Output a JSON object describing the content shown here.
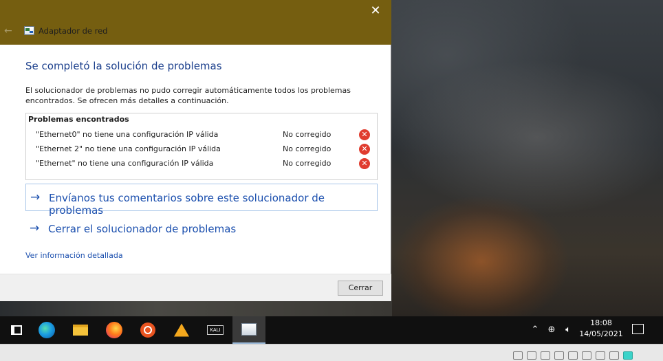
{
  "window": {
    "title": "Adaptador de red",
    "heading": "Se completó la solución de problemas",
    "description": "El solucionador de problemas no pudo corregir automáticamente todos los problemas encontrados. Se ofrecen más detalles a continuación.",
    "problems": {
      "header": "Problemas encontrados",
      "rows": [
        {
          "description": "\"Ethernet0\" no tiene una configuración IP válida",
          "status": "No corregido"
        },
        {
          "description": "\"Ethernet 2\" no tiene una configuración IP válida",
          "status": "No corregido"
        },
        {
          "description": "\"Ethernet\" no tiene una configuración IP válida",
          "status": "No corregido"
        }
      ]
    },
    "links": {
      "feedback": "Envíanos tus comentarios sobre este solucionador de problemas",
      "close_troubleshooter": "Cerrar el solucionador de problemas",
      "details": "Ver información detallada"
    },
    "close_button": "Cerrar",
    "colors": {
      "titlebar": "#755e10",
      "heading": "#1b3f8c",
      "link": "#1b4fae",
      "error": "#e03c2f"
    }
  },
  "taskbar": {
    "apps": [
      {
        "icon": "task-view-icon"
      },
      {
        "icon": "edge-icon"
      },
      {
        "icon": "file-explorer-icon"
      },
      {
        "icon": "firefox-icon"
      },
      {
        "icon": "ubuntu-icon"
      },
      {
        "icon": "aimp-icon"
      },
      {
        "icon": "kali-icon",
        "label": "KALI"
      },
      {
        "icon": "network-adapter-icon",
        "active": true
      }
    ],
    "time": "18:08",
    "date": "14/05/2021"
  }
}
